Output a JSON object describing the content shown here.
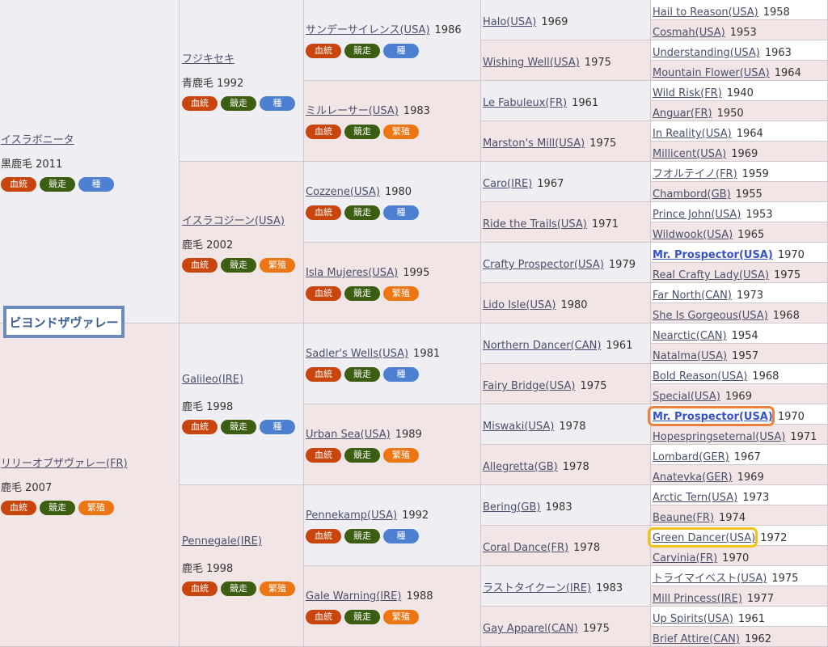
{
  "subject": "ビヨンドザヴァレー",
  "badge_labels": {
    "pedigree": "血統",
    "race": "競走",
    "sire": "種",
    "breeding": "繁殖"
  },
  "gen1": [
    {
      "name": "イスラボニータ",
      "coat": "黒鹿毛 2011",
      "badges": [
        "血統",
        "競走",
        "種"
      ]
    },
    {
      "name": "リリーオブザヴァレー(FR)",
      "coat": "鹿毛 2007",
      "badges": [
        "血統",
        "競走",
        "繁殖"
      ]
    }
  ],
  "gen2": [
    {
      "name": "フジキセキ",
      "coat": "青鹿毛 1992",
      "badges": [
        "血統",
        "競走",
        "種"
      ]
    },
    {
      "name": "イスラコジーン(USA)",
      "coat": "鹿毛 2002",
      "badges": [
        "血統",
        "競走",
        "繁殖"
      ]
    },
    {
      "name": "Galileo(IRE)",
      "coat": "鹿毛 1998",
      "badges": [
        "血統",
        "競走",
        "種"
      ]
    },
    {
      "name": "Pennegale(IRE)",
      "coat": "鹿毛 1998",
      "badges": [
        "血統",
        "競走",
        "繁殖"
      ]
    }
  ],
  "gen3": [
    {
      "name": "サンデーサイレンス(USA)",
      "year": "1986",
      "badges": [
        "血統",
        "競走",
        "種"
      ]
    },
    {
      "name": "ミルレーサー(USA)",
      "year": "1983",
      "badges": [
        "血統",
        "競走",
        "繁殖"
      ]
    },
    {
      "name": "Cozzene(USA)",
      "year": "1980",
      "badges": [
        "血統",
        "競走",
        "種"
      ]
    },
    {
      "name": "Isla Mujeres(USA)",
      "year": "1995",
      "badges": [
        "血統",
        "競走",
        "繁殖"
      ]
    },
    {
      "name": "Sadler's Wells(USA)",
      "year": "1981",
      "badges": [
        "血統",
        "競走",
        "種"
      ]
    },
    {
      "name": "Urban Sea(USA)",
      "year": "1989",
      "badges": [
        "血統",
        "競走",
        "繁殖"
      ]
    },
    {
      "name": "Pennekamp(USA)",
      "year": "1992",
      "badges": [
        "血統",
        "競走",
        "種"
      ]
    },
    {
      "name": "Gale Warning(IRE)",
      "year": "1988",
      "badges": [
        "血統",
        "競走",
        "繁殖"
      ]
    }
  ],
  "gen4": [
    {
      "name": "Halo(USA)",
      "year": "1969"
    },
    {
      "name": "Wishing Well(USA)",
      "year": "1975"
    },
    {
      "name": "Le Fabuleux(FR)",
      "year": "1961"
    },
    {
      "name": "Marston's Mill(USA)",
      "year": "1975"
    },
    {
      "name": "Caro(IRE)",
      "year": "1967"
    },
    {
      "name": "Ride the Trails(USA)",
      "year": "1971"
    },
    {
      "name": "Crafty Prospector(USA)",
      "year": "1979"
    },
    {
      "name": "Lido Isle(USA)",
      "year": "1980"
    },
    {
      "name": "Northern Dancer(CAN)",
      "year": "1961"
    },
    {
      "name": "Fairy Bridge(USA)",
      "year": "1975"
    },
    {
      "name": "Miswaki(USA)",
      "year": "1978"
    },
    {
      "name": "Allegretta(GB)",
      "year": "1978"
    },
    {
      "name": "Bering(GB)",
      "year": "1983"
    },
    {
      "name": "Coral Dance(FR)",
      "year": "1978"
    },
    {
      "name": "ラストタイクーン(IRE)",
      "year": "1983"
    },
    {
      "name": "Gay Apparel(CAN)",
      "year": "1975"
    }
  ],
  "gen5": [
    {
      "name": "Hail to Reason(USA)",
      "year": "1958"
    },
    {
      "name": "Cosmah(USA)",
      "year": "1953"
    },
    {
      "name": "Understanding(USA)",
      "year": "1963"
    },
    {
      "name": "Mountain Flower(USA)",
      "year": "1964"
    },
    {
      "name": "Wild Risk(FR)",
      "year": "1940"
    },
    {
      "name": "Anguar(FR)",
      "year": "1950"
    },
    {
      "name": "In Reality(USA)",
      "year": "1964"
    },
    {
      "name": "Millicent(USA)",
      "year": "1969"
    },
    {
      "name": "フオルテイノ(FR)",
      "year": "1959"
    },
    {
      "name": "Chambord(GB)",
      "year": "1955"
    },
    {
      "name": "Prince John(USA)",
      "year": "1953"
    },
    {
      "name": "Wildwook(USA)",
      "year": "1965"
    },
    {
      "name": "Mr. Prospector(USA)",
      "year": "1970"
    },
    {
      "name": "Real Crafty Lady(USA)",
      "year": "1975"
    },
    {
      "name": "Far North(CAN)",
      "year": "1973"
    },
    {
      "name": "She Is Gorgeous(USA)",
      "year": "1968"
    },
    {
      "name": "Nearctic(CAN)",
      "year": "1954"
    },
    {
      "name": "Natalma(USA)",
      "year": "1957"
    },
    {
      "name": "Bold Reason(USA)",
      "year": "1968"
    },
    {
      "name": "Special(USA)",
      "year": "1969"
    },
    {
      "name": "Mr. Prospector(USA)",
      "year": "1970"
    },
    {
      "name": "Hopespringseternal(USA)",
      "year": "1971"
    },
    {
      "name": "Lombard(GER)",
      "year": "1967"
    },
    {
      "name": "Anatevka(GER)",
      "year": "1969"
    },
    {
      "name": "Arctic Tern(USA)",
      "year": "1973"
    },
    {
      "name": "Beaune(FR)",
      "year": "1974"
    },
    {
      "name": "Green Dancer(USA)",
      "year": "1972"
    },
    {
      "name": "Carvinia(FR)",
      "year": "1970"
    },
    {
      "name": "トライマイベスト(USA)",
      "year": "1975"
    },
    {
      "name": "Mill Princess(IRE)",
      "year": "1977"
    },
    {
      "name": "Up Spirits(USA)",
      "year": "1961"
    },
    {
      "name": "Brief Attire(CAN)",
      "year": "1962"
    }
  ],
  "colors": {
    "pedigree": "#c8450e",
    "race": "#3c5e12",
    "sire": "#4d80d0",
    "breeding": "#ec7514",
    "male_bg": "#efeef3",
    "female_bg": "#f2e5e5",
    "link": "#4a4f6e",
    "bold_link": "#3552c8",
    "subject_border": "#6b8bbd",
    "highlight_orange": "#f0803c",
    "highlight_yellow": "#f1c21c"
  }
}
